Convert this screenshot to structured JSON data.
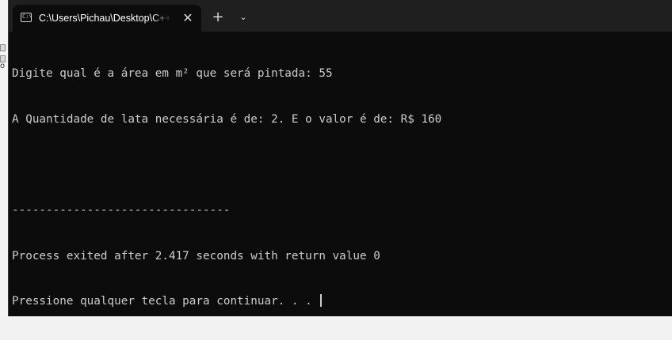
{
  "window": {
    "tab_title": "C:\\Users\\Pichau\\Desktop\\C++",
    "tab_icon": "terminal-icon",
    "close_glyph": "✕",
    "new_tab_glyph": "+",
    "dropdown_glyph": "⌄"
  },
  "console": {
    "lines": [
      "Digite qual é a área em m² que será pintada: 55",
      "A Quantidade de lata necessária é de: 2. E o valor é de: R$ 160",
      "",
      "--------------------------------",
      "Process exited after 2.417 seconds with return value 0",
      "Pressione qualquer tecla para continuar. . . "
    ]
  },
  "backdrop": {
    "glyph": "o"
  },
  "colors": {
    "console_bg": "#0c0c0c",
    "titlebar_bg": "#1f1f1f",
    "text": "#cccccc"
  }
}
